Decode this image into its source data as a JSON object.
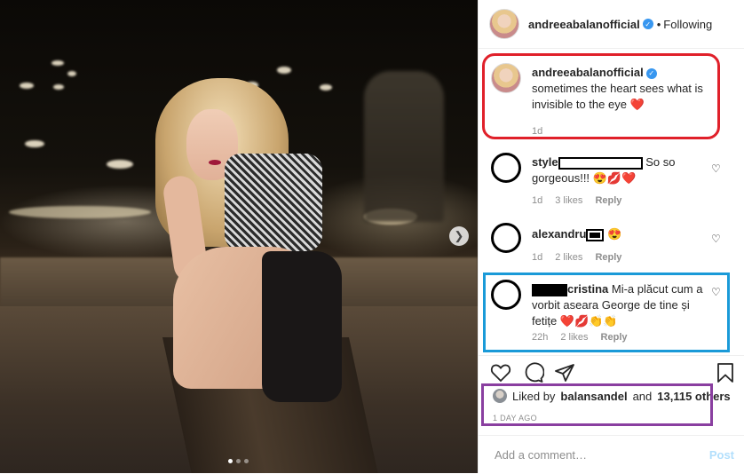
{
  "post": {
    "carousel": {
      "slide_count": 3,
      "active_slide": 1,
      "next_icon": "chevron-right-icon"
    }
  },
  "header": {
    "username": "andreeabalanofficial",
    "verified_icon": "verified-badge-icon",
    "separator": "•",
    "follow_status": "Following"
  },
  "caption": {
    "username": "andreeabalanofficial",
    "text": "sometimes the heart sees what is invisible to the eye",
    "emoji": "❤️",
    "time": "1d"
  },
  "comments": [
    {
      "user_prefix": "style",
      "text": "So so gorgeous!!!",
      "emoji": "😍💋❤️",
      "time": "1d",
      "likes": "3 likes",
      "reply": "Reply"
    },
    {
      "user_prefix": "alexandru",
      "text": "",
      "emoji": "😍",
      "time": "1d",
      "likes": "2 likes",
      "reply": "Reply"
    },
    {
      "user_suffix": "cristina",
      "text": "Mi-a plăcut cum a vorbit aseara George de tine și fetițe",
      "emoji": "❤️💋👏👏",
      "time": "22h",
      "likes": "2 likes",
      "reply": "Reply"
    }
  ],
  "actions": {
    "like_icon": "heart-icon",
    "comment_icon": "comment-bubble-icon",
    "share_icon": "paper-plane-icon",
    "save_icon": "bookmark-icon"
  },
  "likes": {
    "prefix": "Liked by",
    "user": "balansandel",
    "middle": "and",
    "count": "13,115 others"
  },
  "date": "1 DAY AGO",
  "add_comment": {
    "placeholder": "Add a comment…",
    "post_label": "Post"
  },
  "annotation_colors": {
    "caption_box": "#e0202a",
    "comment_box": "#1a9ad8",
    "likes_box": "#8a3fa0"
  }
}
